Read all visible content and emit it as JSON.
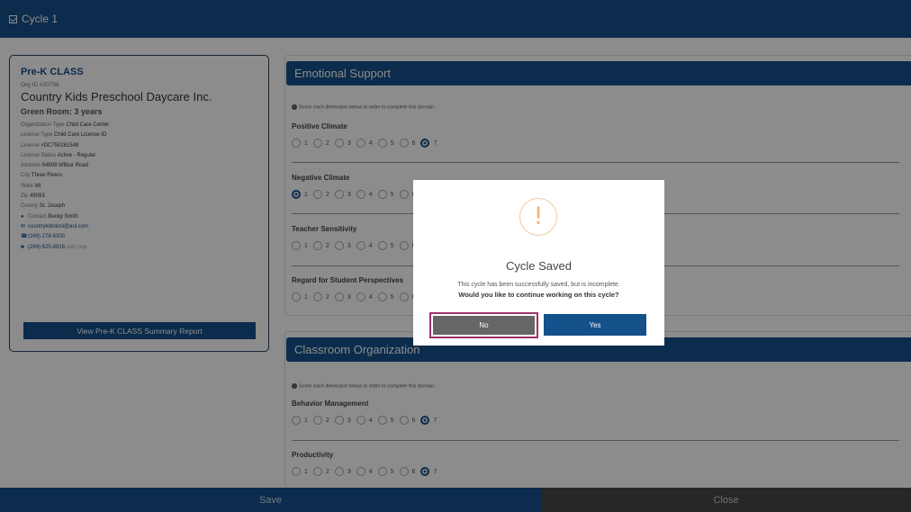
{
  "header": {
    "title": "Cycle 1"
  },
  "info": {
    "class_title": "Pre-K CLASS",
    "org_id": "Org ID #20798",
    "org_name": "Country Kids Preschool Daycare Inc.",
    "room": "Green Room: 3 years",
    "rows": [
      {
        "label": "Organization Type",
        "value": "Child Care Center"
      },
      {
        "label": "License Type",
        "value": "Child Care License ID"
      },
      {
        "label": "License #",
        "value": "DC750261548"
      },
      {
        "label": "License Status",
        "value": "Active - Regular"
      },
      {
        "label": "Address",
        "value": "54609 Wilbur Road"
      },
      {
        "label": "City",
        "value": "Three Rivers"
      },
      {
        "label": "State",
        "value": "MI"
      },
      {
        "label": "Zip",
        "value": "49093"
      },
      {
        "label": "County",
        "value": "St. Joseph"
      }
    ],
    "contact_label": "Contact",
    "contact_name": "Becky Smith",
    "email": "countrykidstoni@aol.com",
    "phone": "(269) 278-6300",
    "sms_phone": "(269) 625-8816",
    "sms_note": "SMS Only",
    "summary_button": "View Pre-K CLASS Summary Report"
  },
  "domains": [
    {
      "title": "Emotional Support",
      "hint": "Score each dimension below in order to complete this domain.",
      "dimensions": [
        {
          "name": "Positive Climate",
          "selected": 7
        },
        {
          "name": "Negative Climate",
          "selected": 1
        },
        {
          "name": "Teacher Sensitivity",
          "selected": null
        },
        {
          "name": "Regard for Student Perspectives",
          "selected": null
        }
      ]
    },
    {
      "title": "Classroom Organization",
      "hint": "Score each dimension below in order to complete this domain.",
      "dimensions": [
        {
          "name": "Behavior Management",
          "selected": 7
        },
        {
          "name": "Productivity",
          "selected": 7
        }
      ]
    }
  ],
  "scale": [
    "1",
    "2",
    "3",
    "4",
    "5",
    "6",
    "7"
  ],
  "modal": {
    "icon": "!",
    "title": "Cycle Saved",
    "message": "This cycle has been successfully saved, but is incomplete.",
    "question": "Would you like to continue working on this cycle?",
    "no_label": "No",
    "yes_label": "Yes"
  },
  "footer": {
    "save_label": "Save",
    "close_label": "Close"
  },
  "colors": {
    "primary": "#14508a",
    "dark": "#474747",
    "warning": "#f2b27a",
    "focus": "#a0306a"
  }
}
